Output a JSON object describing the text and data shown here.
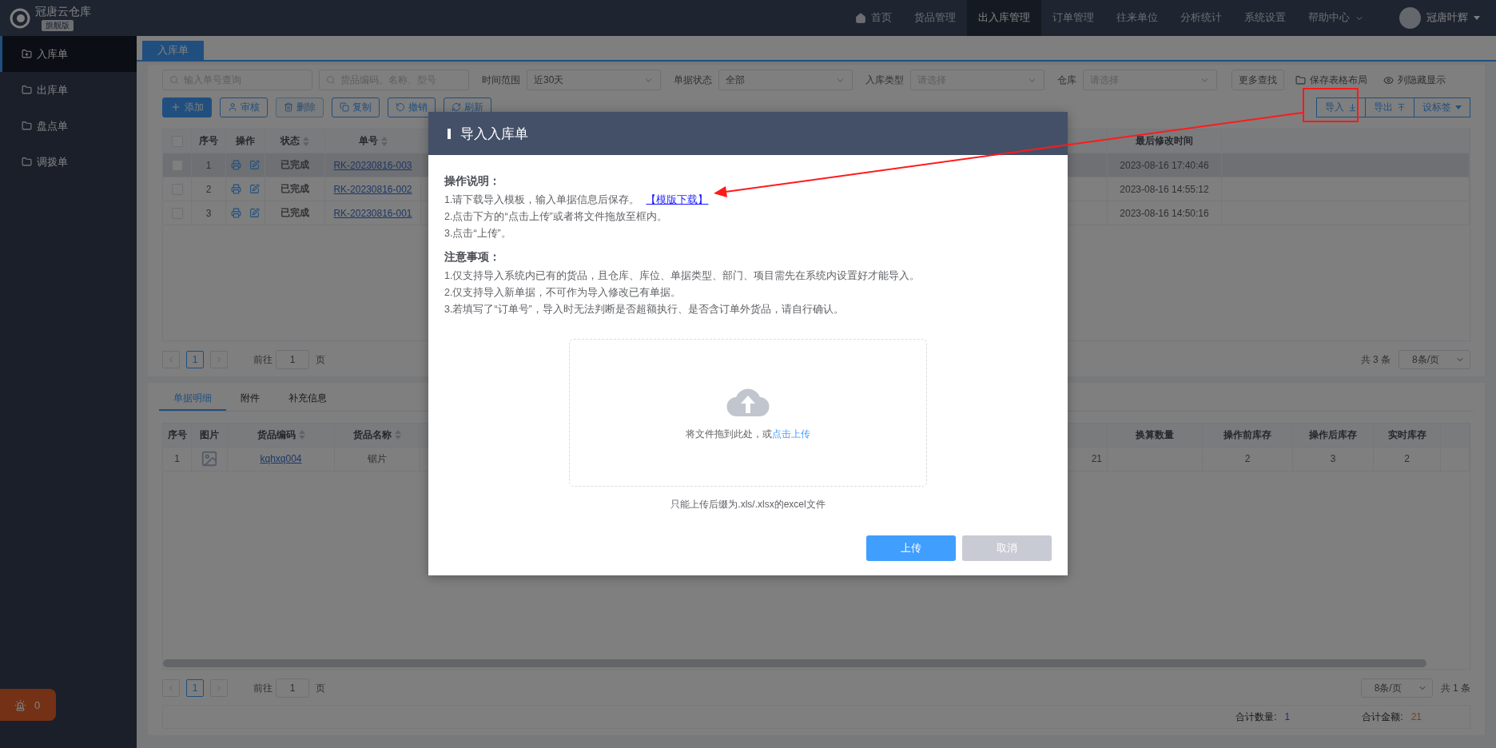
{
  "brand": {
    "name": "冠唐云仓库",
    "edition": "旗舰版"
  },
  "nav": [
    {
      "label": "首页",
      "selected": false,
      "kind": "home"
    },
    {
      "label": "货品管理",
      "selected": false,
      "kind": "link"
    },
    {
      "label": "出入库管理",
      "selected": true,
      "kind": "link"
    },
    {
      "label": "订单管理",
      "selected": false,
      "kind": "link"
    },
    {
      "label": "往来单位",
      "selected": false,
      "kind": "link"
    },
    {
      "label": "分析统计",
      "selected": false,
      "kind": "link"
    },
    {
      "label": "系统设置",
      "selected": false,
      "kind": "link"
    },
    {
      "label": "帮助中心",
      "selected": false,
      "kind": "menu"
    }
  ],
  "user": {
    "name": "冠唐叶辉"
  },
  "sidebar": {
    "items": [
      {
        "label": "入库单",
        "selected": true
      },
      {
        "label": "出库单",
        "selected": false
      },
      {
        "label": "盘点单",
        "selected": false
      },
      {
        "label": "调拨单",
        "selected": false
      }
    ]
  },
  "alarm": {
    "count": "0"
  },
  "page_tabs": [
    {
      "label": "入库单",
      "selected": true
    }
  ],
  "filters": [
    {
      "kind": "search",
      "placeholder": "输入单号查询"
    },
    {
      "kind": "search",
      "placeholder": "货品编码、名称、型号"
    },
    {
      "kind": "select",
      "label": "时间范围",
      "value": "近30天"
    },
    {
      "kind": "select",
      "label": "单据状态",
      "value": "全部"
    },
    {
      "kind": "select",
      "label": "入库类型",
      "placeholder": "请选择"
    },
    {
      "kind": "select",
      "label": "仓库",
      "placeholder": "请选择"
    }
  ],
  "filter_actions": [
    {
      "kind": "button",
      "label": "更多查找"
    },
    {
      "kind": "folder",
      "label": "保存表格布局"
    },
    {
      "kind": "eye",
      "label": "列隐藏显示"
    }
  ],
  "toolbar": [
    {
      "label": "添加",
      "kind": "primary",
      "disabled": false
    },
    {
      "label": "审核",
      "kind": "default",
      "disabled": false
    },
    {
      "label": "删除",
      "kind": "default",
      "disabled": true
    },
    {
      "label": "复制",
      "kind": "default",
      "disabled": false
    },
    {
      "label": "撤销",
      "kind": "default",
      "disabled": false
    },
    {
      "label": "刷新",
      "kind": "default",
      "disabled": false
    }
  ],
  "toolbar_right": [
    {
      "label": "导入"
    },
    {
      "label": "导出"
    },
    {
      "label": "设标签"
    }
  ],
  "orders_table": {
    "all_checked": false,
    "columns": [
      {
        "label": "序号",
        "sortable": false
      },
      {
        "label": "操作",
        "sortable": false
      },
      {
        "label": "状态",
        "sortable": true
      },
      {
        "label": "单号",
        "sortable": true
      },
      {
        "label": "最后修改时间",
        "sortable": false
      }
    ],
    "rows": [
      {
        "selected": true,
        "checked": false,
        "index": "1",
        "status": "已完成",
        "order_no": "RK-20230816-003",
        "modified": "2023-08-16 17:40:46"
      },
      {
        "selected": false,
        "checked": false,
        "index": "2",
        "status": "已完成",
        "order_no": "RK-20230816-002",
        "modified": "2023-08-16 14:55:12"
      },
      {
        "selected": false,
        "checked": false,
        "index": "3",
        "status": "已完成",
        "order_no": "RK-20230816-001",
        "modified": "2023-08-16 14:50:16"
      }
    ]
  },
  "orders_pagination": {
    "pages": [
      {
        "label": "1",
        "selected": true
      }
    ],
    "goto_label": "前往",
    "goto_value": "1",
    "goto_suffix": "页",
    "total": "共 3 条",
    "page_size": "8条/页"
  },
  "detail_tabs": [
    {
      "label": "单据明细",
      "selected": true
    },
    {
      "label": "附件",
      "selected": false
    },
    {
      "label": "补充信息",
      "selected": false
    }
  ],
  "detail_table": {
    "columns": [
      {
        "label": "序号",
        "sortable": false
      },
      {
        "label": "图片",
        "sortable": false
      },
      {
        "label": "货品编码",
        "sortable": true
      },
      {
        "label": "货品名称",
        "sortable": true
      },
      {
        "label": "换算数量",
        "sortable": false
      },
      {
        "label": "操作前库存",
        "sortable": false
      },
      {
        "label": "操作后库存",
        "sortable": false
      },
      {
        "label": "实时库存",
        "sortable": false
      }
    ],
    "rows": [
      {
        "index": "1",
        "code": "kqhxq004",
        "name": "锯片",
        "column_5": "21",
        "stock_before": "2",
        "stock_after": "3",
        "stock_now": "2"
      }
    ]
  },
  "detail_pagination": {
    "pages": [
      {
        "label": "1",
        "selected": true
      }
    ],
    "goto_label": "前往",
    "goto_value": "1",
    "goto_suffix": "页",
    "total": "共 1 条",
    "page_size": "8条/页"
  },
  "totals": [
    {
      "label": "合计数量:",
      "value": "1",
      "kind": "quantity"
    },
    {
      "label": "合计金额:",
      "value": "21",
      "kind": "amount"
    }
  ],
  "modal": {
    "title": "导入入库单",
    "sections": [
      {
        "heading": "操作说明：",
        "lines": [
          {
            "text": "1.请下载导入模板，输入单据信息后保存。",
            "link": "【模版下载】"
          },
          {
            "text": "2.点击下方的“点击上传”或者将文件拖放至框内。"
          },
          {
            "text": "3.点击“上传”。"
          }
        ]
      },
      {
        "heading": "注意事项：",
        "lines": [
          {
            "text": "1.仅支持导入系统内已有的货品，且仓库、库位、单据类型、部门、项目需先在系统内设置好才能导入。"
          },
          {
            "text": "2.仅支持导入新单据，不可作为导入修改已有单据。"
          },
          {
            "text": "3.若填写了“订单号”，导入时无法判断是否超额执行、是否含订单外货品，请自行确认。"
          }
        ]
      }
    ],
    "dropzone": {
      "text": "将文件拖到此处，或",
      "link": "点击上传"
    },
    "hint": "只能上传后缀为.xls/.xlsx的excel文件",
    "buttons": [
      {
        "label": "上传",
        "kind": "primary"
      },
      {
        "label": "取消",
        "kind": "secondary"
      }
    ]
  }
}
